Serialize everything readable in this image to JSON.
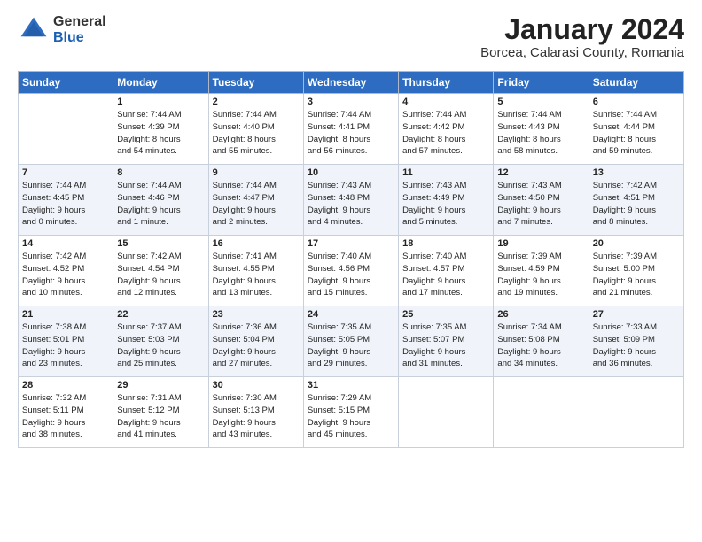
{
  "logo": {
    "general": "General",
    "blue": "Blue"
  },
  "header": {
    "month": "January 2024",
    "location": "Borcea, Calarasi County, Romania"
  },
  "days_of_week": [
    "Sunday",
    "Monday",
    "Tuesday",
    "Wednesday",
    "Thursday",
    "Friday",
    "Saturday"
  ],
  "weeks": [
    [
      {
        "num": "",
        "lines": []
      },
      {
        "num": "1",
        "lines": [
          "Sunrise: 7:44 AM",
          "Sunset: 4:39 PM",
          "Daylight: 8 hours",
          "and 54 minutes."
        ]
      },
      {
        "num": "2",
        "lines": [
          "Sunrise: 7:44 AM",
          "Sunset: 4:40 PM",
          "Daylight: 8 hours",
          "and 55 minutes."
        ]
      },
      {
        "num": "3",
        "lines": [
          "Sunrise: 7:44 AM",
          "Sunset: 4:41 PM",
          "Daylight: 8 hours",
          "and 56 minutes."
        ]
      },
      {
        "num": "4",
        "lines": [
          "Sunrise: 7:44 AM",
          "Sunset: 4:42 PM",
          "Daylight: 8 hours",
          "and 57 minutes."
        ]
      },
      {
        "num": "5",
        "lines": [
          "Sunrise: 7:44 AM",
          "Sunset: 4:43 PM",
          "Daylight: 8 hours",
          "and 58 minutes."
        ]
      },
      {
        "num": "6",
        "lines": [
          "Sunrise: 7:44 AM",
          "Sunset: 4:44 PM",
          "Daylight: 8 hours",
          "and 59 minutes."
        ]
      }
    ],
    [
      {
        "num": "7",
        "lines": [
          "Sunrise: 7:44 AM",
          "Sunset: 4:45 PM",
          "Daylight: 9 hours",
          "and 0 minutes."
        ]
      },
      {
        "num": "8",
        "lines": [
          "Sunrise: 7:44 AM",
          "Sunset: 4:46 PM",
          "Daylight: 9 hours",
          "and 1 minute."
        ]
      },
      {
        "num": "9",
        "lines": [
          "Sunrise: 7:44 AM",
          "Sunset: 4:47 PM",
          "Daylight: 9 hours",
          "and 2 minutes."
        ]
      },
      {
        "num": "10",
        "lines": [
          "Sunrise: 7:43 AM",
          "Sunset: 4:48 PM",
          "Daylight: 9 hours",
          "and 4 minutes."
        ]
      },
      {
        "num": "11",
        "lines": [
          "Sunrise: 7:43 AM",
          "Sunset: 4:49 PM",
          "Daylight: 9 hours",
          "and 5 minutes."
        ]
      },
      {
        "num": "12",
        "lines": [
          "Sunrise: 7:43 AM",
          "Sunset: 4:50 PM",
          "Daylight: 9 hours",
          "and 7 minutes."
        ]
      },
      {
        "num": "13",
        "lines": [
          "Sunrise: 7:42 AM",
          "Sunset: 4:51 PM",
          "Daylight: 9 hours",
          "and 8 minutes."
        ]
      }
    ],
    [
      {
        "num": "14",
        "lines": [
          "Sunrise: 7:42 AM",
          "Sunset: 4:52 PM",
          "Daylight: 9 hours",
          "and 10 minutes."
        ]
      },
      {
        "num": "15",
        "lines": [
          "Sunrise: 7:42 AM",
          "Sunset: 4:54 PM",
          "Daylight: 9 hours",
          "and 12 minutes."
        ]
      },
      {
        "num": "16",
        "lines": [
          "Sunrise: 7:41 AM",
          "Sunset: 4:55 PM",
          "Daylight: 9 hours",
          "and 13 minutes."
        ]
      },
      {
        "num": "17",
        "lines": [
          "Sunrise: 7:40 AM",
          "Sunset: 4:56 PM",
          "Daylight: 9 hours",
          "and 15 minutes."
        ]
      },
      {
        "num": "18",
        "lines": [
          "Sunrise: 7:40 AM",
          "Sunset: 4:57 PM",
          "Daylight: 9 hours",
          "and 17 minutes."
        ]
      },
      {
        "num": "19",
        "lines": [
          "Sunrise: 7:39 AM",
          "Sunset: 4:59 PM",
          "Daylight: 9 hours",
          "and 19 minutes."
        ]
      },
      {
        "num": "20",
        "lines": [
          "Sunrise: 7:39 AM",
          "Sunset: 5:00 PM",
          "Daylight: 9 hours",
          "and 21 minutes."
        ]
      }
    ],
    [
      {
        "num": "21",
        "lines": [
          "Sunrise: 7:38 AM",
          "Sunset: 5:01 PM",
          "Daylight: 9 hours",
          "and 23 minutes."
        ]
      },
      {
        "num": "22",
        "lines": [
          "Sunrise: 7:37 AM",
          "Sunset: 5:03 PM",
          "Daylight: 9 hours",
          "and 25 minutes."
        ]
      },
      {
        "num": "23",
        "lines": [
          "Sunrise: 7:36 AM",
          "Sunset: 5:04 PM",
          "Daylight: 9 hours",
          "and 27 minutes."
        ]
      },
      {
        "num": "24",
        "lines": [
          "Sunrise: 7:35 AM",
          "Sunset: 5:05 PM",
          "Daylight: 9 hours",
          "and 29 minutes."
        ]
      },
      {
        "num": "25",
        "lines": [
          "Sunrise: 7:35 AM",
          "Sunset: 5:07 PM",
          "Daylight: 9 hours",
          "and 31 minutes."
        ]
      },
      {
        "num": "26",
        "lines": [
          "Sunrise: 7:34 AM",
          "Sunset: 5:08 PM",
          "Daylight: 9 hours",
          "and 34 minutes."
        ]
      },
      {
        "num": "27",
        "lines": [
          "Sunrise: 7:33 AM",
          "Sunset: 5:09 PM",
          "Daylight: 9 hours",
          "and 36 minutes."
        ]
      }
    ],
    [
      {
        "num": "28",
        "lines": [
          "Sunrise: 7:32 AM",
          "Sunset: 5:11 PM",
          "Daylight: 9 hours",
          "and 38 minutes."
        ]
      },
      {
        "num": "29",
        "lines": [
          "Sunrise: 7:31 AM",
          "Sunset: 5:12 PM",
          "Daylight: 9 hours",
          "and 41 minutes."
        ]
      },
      {
        "num": "30",
        "lines": [
          "Sunrise: 7:30 AM",
          "Sunset: 5:13 PM",
          "Daylight: 9 hours",
          "and 43 minutes."
        ]
      },
      {
        "num": "31",
        "lines": [
          "Sunrise: 7:29 AM",
          "Sunset: 5:15 PM",
          "Daylight: 9 hours",
          "and 45 minutes."
        ]
      },
      {
        "num": "",
        "lines": []
      },
      {
        "num": "",
        "lines": []
      },
      {
        "num": "",
        "lines": []
      }
    ]
  ]
}
